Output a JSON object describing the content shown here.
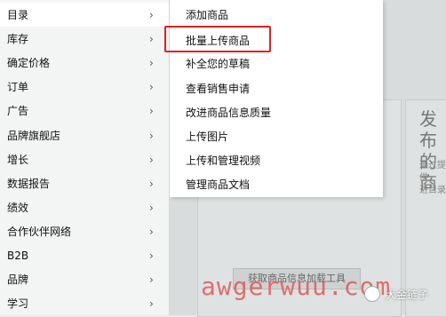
{
  "menu": {
    "items": [
      {
        "label": "目录",
        "chevron": "›"
      },
      {
        "label": "库存",
        "chevron": "›"
      },
      {
        "label": "确定价格",
        "chevron": "›"
      },
      {
        "label": "订单",
        "chevron": "›"
      },
      {
        "label": "广告",
        "chevron": "›"
      },
      {
        "label": "品牌旗舰店",
        "chevron": "›"
      },
      {
        "label": "增长",
        "chevron": "›"
      },
      {
        "label": "数据报告",
        "chevron": "›"
      },
      {
        "label": "绩效",
        "chevron": "›"
      },
      {
        "label": "合作伙伴网络",
        "chevron": "›"
      },
      {
        "label": "B2B",
        "chevron": "›"
      },
      {
        "label": "品牌",
        "chevron": "›"
      },
      {
        "label": "学习",
        "chevron": "›"
      }
    ]
  },
  "submenu": {
    "items": [
      {
        "label": "添加商品"
      },
      {
        "label": "批量上传商品"
      },
      {
        "label": "补全您的草稿"
      },
      {
        "label": "查看销售申请"
      },
      {
        "label": "改进商品信息质量"
      },
      {
        "label": "上传图片"
      },
      {
        "label": "上传和管理视频"
      },
      {
        "label": "管理商品文档"
      }
    ],
    "highlight_color": "#e32020"
  },
  "background": {
    "card_title": "发布的商",
    "card_text": "通过提供\n进目录",
    "button_label": "获取商品信息加载工具"
  },
  "watermark": {
    "text": "awgerwuu.com",
    "badge": "大金链子"
  }
}
